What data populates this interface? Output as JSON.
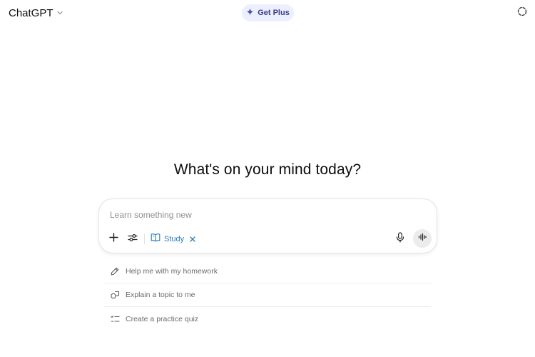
{
  "header": {
    "model_name": "ChatGPT",
    "model_dropdown_icon": "chevron-down-icon",
    "get_plus_label": "Get Plus",
    "get_plus_icon": "sparkle-icon",
    "temporary_chat_icon": "dashed-circle-icon"
  },
  "main": {
    "heading": "What's on your mind today?"
  },
  "composer": {
    "placeholder": "Learn something new",
    "value": "",
    "add_icon": "plus-icon",
    "tools_icon": "sliders-icon",
    "active_tool": {
      "label": "Study",
      "icon": "book-icon",
      "remove_icon": "close-icon"
    },
    "mic_icon": "microphone-icon",
    "voice_icon": "audio-waveform-icon"
  },
  "suggestions": [
    {
      "label": "Help me with my homework",
      "icon": "pencil-icon"
    },
    {
      "label": "Explain a topic to me",
      "icon": "shapes-icon"
    },
    {
      "label": "Create a practice quiz",
      "icon": "checklist-icon"
    }
  ],
  "colors": {
    "accent_study": "#2a7bb8",
    "get_plus_bg": "#eceffd",
    "get_plus_text": "#3d3d8a",
    "suggestion_text": "#6b6b6b"
  }
}
